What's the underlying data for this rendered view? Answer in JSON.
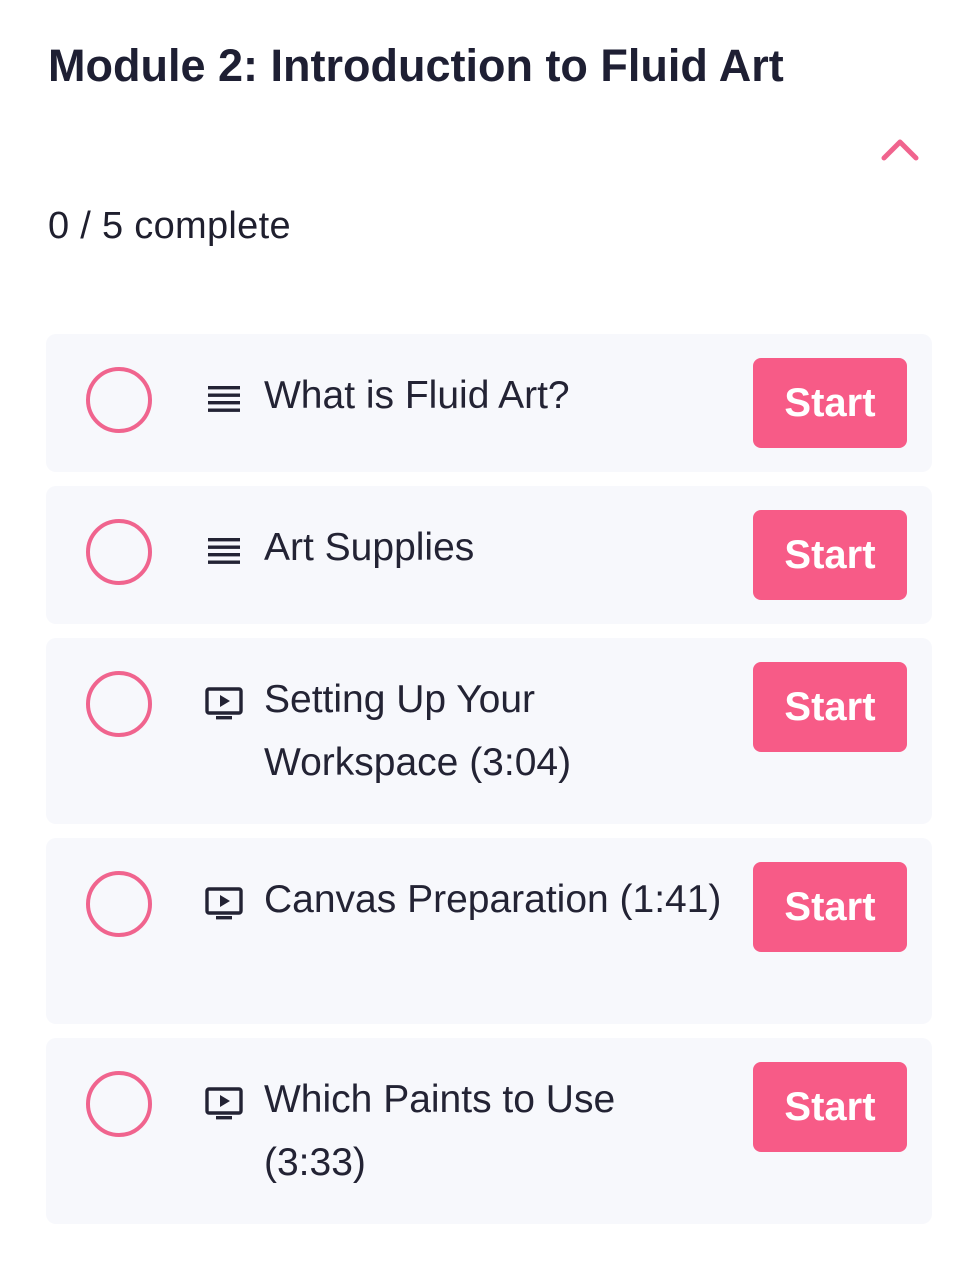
{
  "module": {
    "title": "Module 2: Introduction to Fluid Art",
    "progress": "0 / 5 complete",
    "collapse_icon": "chevron-up-icon",
    "accent_color": "#f75b87"
  },
  "lessons": [
    {
      "type_icon": "text-lines-icon",
      "title": "What is Fluid Art?",
      "action": "Start"
    },
    {
      "type_icon": "text-lines-icon",
      "title": "Art Supplies",
      "action": "Start"
    },
    {
      "type_icon": "video-play-icon",
      "title": "Setting Up Your Workspace (3:04)",
      "action": "Start"
    },
    {
      "type_icon": "video-play-icon",
      "title": "Canvas Preparation (1:41)",
      "action": "Start"
    },
    {
      "type_icon": "video-play-icon",
      "title": "Which Paints to Use (3:33)",
      "action": "Start"
    }
  ]
}
